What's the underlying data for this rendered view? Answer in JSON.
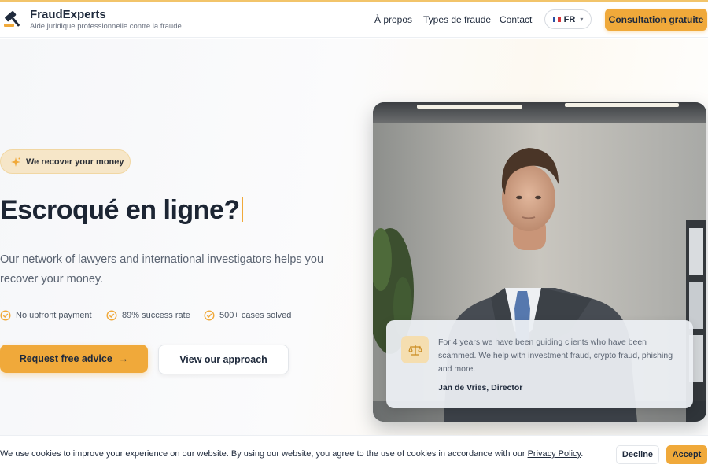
{
  "brand": {
    "name": "FraudExperts",
    "tagline": "Aide juridique professionnelle contre la fraude"
  },
  "nav": {
    "links": [
      "À propos",
      "Types de fraude",
      "Contact"
    ],
    "language": "FR",
    "cta": "Consultation gratuite"
  },
  "hero": {
    "badge": "We recover your money",
    "headline": "Escroqué en ligne?",
    "lead": "Our network of lawyers and international investigators helps you recover your money.",
    "features": [
      "No upfront payment",
      "89% success rate",
      "500+ cases solved"
    ],
    "primary_button": "Request free advice",
    "secondary_button": "View our approach"
  },
  "testimonial": {
    "text": "For 4 years we have been guiding clients who have been scammed. We help with investment fraud, crypto fraud, phishing and more.",
    "author": "Jan de Vries, Director"
  },
  "cookie": {
    "text": "We use cookies to improve your experience on our website. By using our website, you agree to the use of cookies in accordance with our ",
    "link": "Privacy Policy",
    "suffix": ".",
    "decline": "Decline",
    "accept": "Accept"
  },
  "icons": {
    "logo": "gavel-icon",
    "badge": "sparkle-icon",
    "feature": "check-circle-icon",
    "arrow": "arrow-right-icon",
    "quote": "scales-icon",
    "language": "chevron-down-icon"
  },
  "colors": {
    "accent": "#f0a93a",
    "badge_bg": "#f6e6c8",
    "text_dark": "#1c2533",
    "text_muted": "#5b6472"
  }
}
